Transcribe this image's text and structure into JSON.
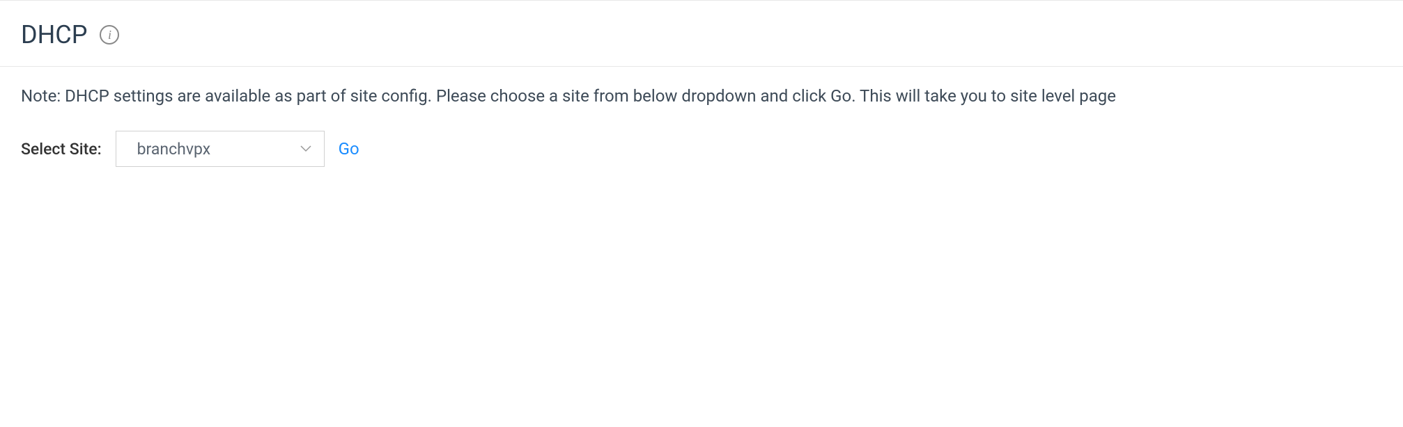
{
  "header": {
    "title": "DHCP"
  },
  "content": {
    "note": "Note: DHCP settings are available as part of site config. Please choose a site from below dropdown and click Go. This will take you to site level page",
    "select_label": "Select Site:",
    "select_value": "branchvpx",
    "go_label": "Go"
  }
}
